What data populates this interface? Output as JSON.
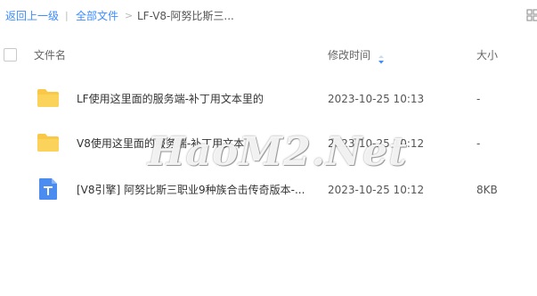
{
  "breadcrumb": {
    "back": "返回上一级",
    "separator1": "|",
    "root": "全部文件",
    "separator2": ">",
    "current": "LF-V8-阿努比斯三..."
  },
  "header": {
    "name": "文件名",
    "modified": "修改时间",
    "size": "大小"
  },
  "rows": [
    {
      "name": "LF使用这里面的服务端-补丁用文本里的",
      "modified": "2023-10-25 10:13",
      "size": "-",
      "icon": "folder-icon"
    },
    {
      "name": "V8使用这里面的服务端-补丁用文本",
      "modified": "2023-10-25 10:12",
      "size": "-",
      "icon": "folder-icon"
    },
    {
      "name": "[V8引擎] 阿努比斯三职业9种族合击传奇版本-...",
      "modified": "2023-10-25 10:12",
      "size": "8KB",
      "icon": "text-file-icon"
    }
  ],
  "watermark": "HaoM2.Net",
  "colors": {
    "link": "#3b8cff",
    "folder": "#f9c846",
    "text_file": "#4a8cf0",
    "sort_arrow": "#3b8cff"
  }
}
